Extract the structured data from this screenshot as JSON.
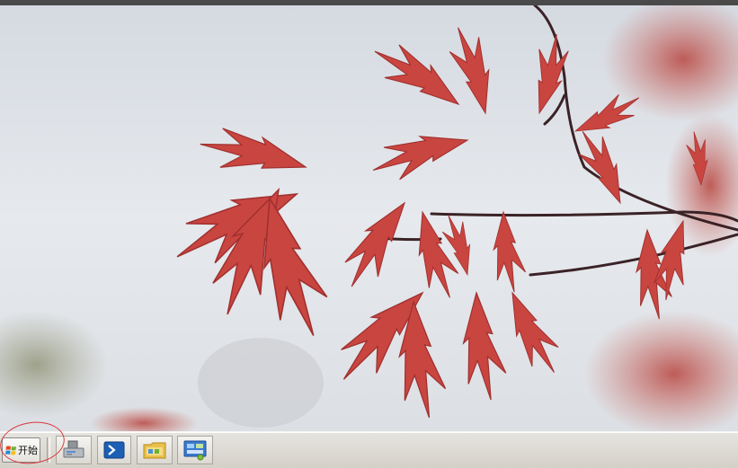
{
  "taskbar": {
    "start_label": "开始",
    "quick_launch": [
      {
        "icon": "server-manager-icon"
      },
      {
        "icon": "powershell-icon"
      },
      {
        "icon": "explorer-folder-icon"
      },
      {
        "icon": "control-panel-icon"
      }
    ]
  },
  "desktop": {
    "wallpaper": "red-maple-leaves-against-sky"
  },
  "colors": {
    "taskbar_bg": "#d4d0c8",
    "annotation": "#d9363e",
    "leaf_red": "#c8403f",
    "sky": "#e2e6eb"
  }
}
